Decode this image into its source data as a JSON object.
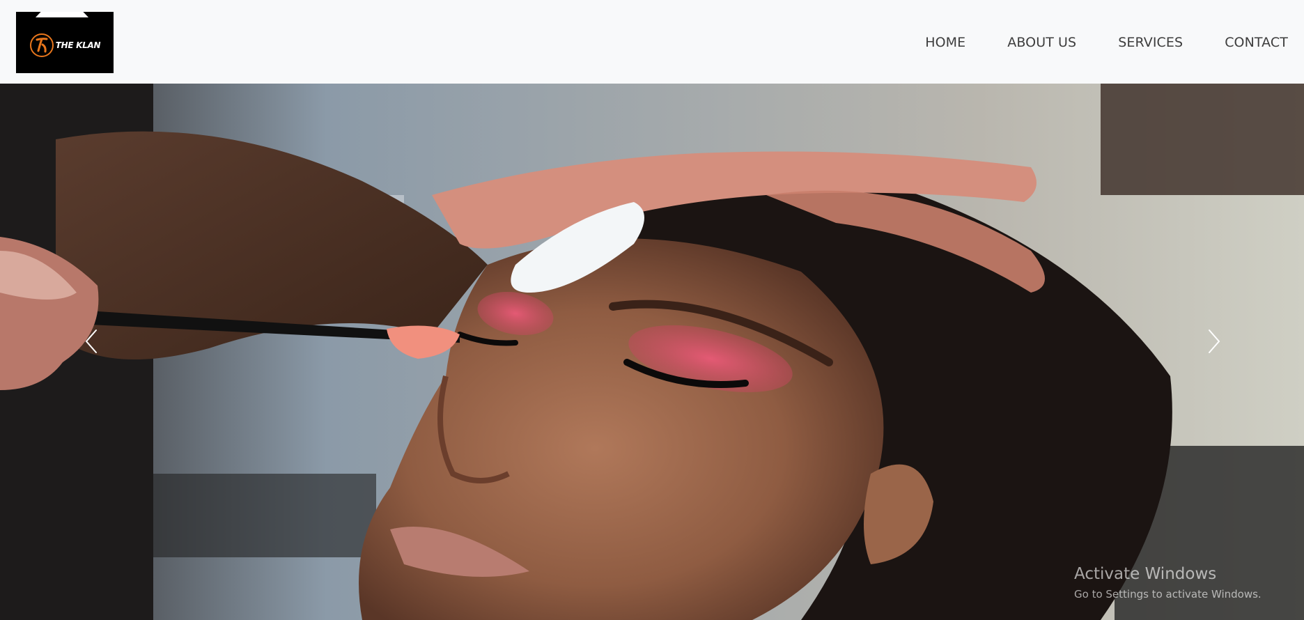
{
  "brand": {
    "name": "THE KLAN",
    "logo_icon": "k-monogram-icon",
    "accent": "#e8761c"
  },
  "nav": {
    "items": [
      {
        "label": "HOME"
      },
      {
        "label": "ABOUT US"
      },
      {
        "label": "SERVICES"
      },
      {
        "label": "CONTACT"
      }
    ]
  },
  "hero": {
    "image": "makeup-artist-applying-pink-eyeshadow",
    "prev_icon": "chevron-left-icon",
    "next_icon": "chevron-right-icon"
  },
  "watermark": {
    "title": "Activate Windows",
    "subtitle": "Go to Settings to activate Windows."
  },
  "colors": {
    "header_bg": "#f8f9fa",
    "nav_text": "#3d3d3d",
    "logo_bg": "#000000"
  }
}
